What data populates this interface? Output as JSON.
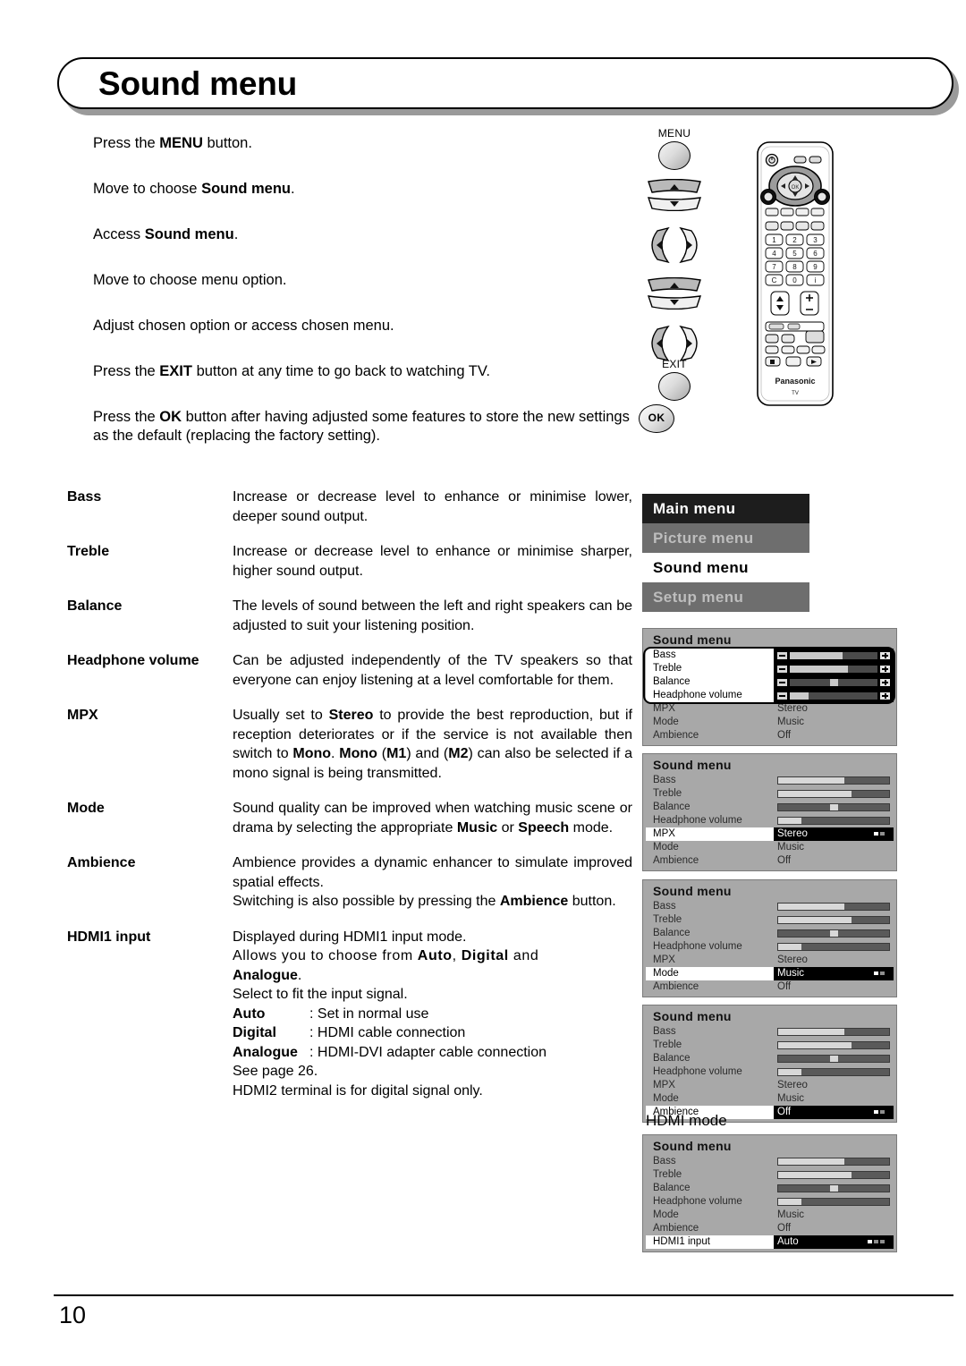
{
  "page": {
    "title": "Sound menu",
    "number": "10"
  },
  "steps": [
    {
      "id": "menu",
      "html": "Press the <b>MENU</b> button."
    },
    {
      "id": "move1",
      "html": "Move to choose <b>Sound menu</b>."
    },
    {
      "id": "access",
      "html": "Access <b>Sound menu</b>."
    },
    {
      "id": "move2",
      "html": "Move to choose menu option."
    },
    {
      "id": "adjust",
      "html": "Adjust chosen option or access chosen menu."
    },
    {
      "id": "exit",
      "html": "Press the <b>EXIT</b> button at any time to go back to watching TV."
    },
    {
      "id": "ok",
      "html": "Press the <b>OK</b> button after having adjusted some features to store the new settings as the default (replacing the factory setting)."
    }
  ],
  "remote_keys": {
    "menu_label": "MENU",
    "exit_label": "EXIT",
    "ok_label": "OK"
  },
  "remote_device": {
    "brand": "Panasonic",
    "sub_brand": "TV",
    "numbers": [
      "1",
      "2",
      "3",
      "4",
      "5",
      "6",
      "7",
      "8",
      "9",
      "C",
      "0"
    ]
  },
  "features": [
    {
      "term": "Bass",
      "desc_html": "Increase or decrease level to enhance or minimise lower, deeper sound output."
    },
    {
      "term": "Treble",
      "desc_html": "Increase or decrease level to enhance or minimise sharper, higher sound output."
    },
    {
      "term": "Balance",
      "desc_html": "The levels of sound between the left and right speakers can be adjusted to suit your listening position."
    },
    {
      "term": "Headphone volume",
      "desc_html": "Can be adjusted independently of the TV speakers so that everyone can enjoy listening at a level comfortable for them."
    },
    {
      "term": "MPX",
      "desc_html": "Usually set to <b>Stereo</b> to provide the best reproduction, but if reception deteriorates or if the service is not available then switch to <b>Mono</b>. <b>Mono</b> (<b>M1</b>) and (<b>M2</b>) can also be selected if a mono signal is being transmitted."
    },
    {
      "term": "Mode",
      "desc_html": "Sound quality can be improved when watching music scene or drama by selecting the appropriate <b>Music</b> or <b>Speech</b> mode."
    },
    {
      "term": "Ambience",
      "desc_html": "Ambience provides a dynamic enhancer to simulate improved spatial effects.<br>Switching is also possible by pressing the <b>Ambience</b> button."
    },
    {
      "term": "HDMI1 input",
      "desc_html": "Displayed during HDMI1 input mode.<br><span class=\"spaced\">Allows you to choose from <b>Auto</b>, <b>Digital</b> and</span><br><b>Analogue</b>.<br>Select to fit the input signal.<div class=\"kv\"><span class=\"k\">Auto</span><span class=\"v\">: Set in normal use</span></div><div class=\"kv\"><span class=\"k\">Digital</span><span class=\"v\">: HDMI cable connection</span></div><div class=\"kv\"><span class=\"k\">Analogue</span><span class=\"v\">: HDMI-DVI adapter cable connection</span></div>See page 26.<br>HDMI2 terminal is for digital signal only."
    }
  ],
  "main_menu": {
    "title": "Main menu",
    "items": [
      {
        "label": "Picture menu",
        "state": "dim"
      },
      {
        "label": "Sound menu",
        "state": "selected"
      },
      {
        "label": "Setup menu",
        "state": "dim"
      }
    ]
  },
  "hdmi_caption": "HDMI mode",
  "osd_screens": [
    {
      "id": "osd-adjust-bars",
      "title": "Sound menu",
      "boxed_rows": 4,
      "rows": [
        {
          "label": "Bass",
          "type": "bar",
          "fill": 60,
          "boxed": true
        },
        {
          "label": "Treble",
          "type": "bar",
          "fill": 66,
          "boxed": true
        },
        {
          "label": "Balance",
          "type": "bar",
          "fill": 0,
          "knob": 50,
          "boxed": true
        },
        {
          "label": "Headphone volume",
          "type": "bar",
          "fill": 21,
          "boxed": true
        },
        {
          "label": "MPX",
          "type": "text",
          "value": "Stereo"
        },
        {
          "label": "Mode",
          "type": "text",
          "value": "Music"
        },
        {
          "label": "Ambience",
          "type": "text",
          "value": "Off"
        }
      ]
    },
    {
      "id": "osd-mpx",
      "title": "Sound menu",
      "rows": [
        {
          "label": "Bass",
          "type": "bar",
          "fill": 60
        },
        {
          "label": "Treble",
          "type": "bar",
          "fill": 66
        },
        {
          "label": "Balance",
          "type": "bar",
          "fill": 0,
          "knob": 50
        },
        {
          "label": "Headphone volume",
          "type": "bar",
          "fill": 21
        },
        {
          "label": "MPX",
          "type": "text",
          "value": "Stereo",
          "selected": true
        },
        {
          "label": "Mode",
          "type": "text",
          "value": "Music"
        },
        {
          "label": "Ambience",
          "type": "text",
          "value": "Off"
        }
      ]
    },
    {
      "id": "osd-mode",
      "title": "Sound menu",
      "rows": [
        {
          "label": "Bass",
          "type": "bar",
          "fill": 60
        },
        {
          "label": "Treble",
          "type": "bar",
          "fill": 66
        },
        {
          "label": "Balance",
          "type": "bar",
          "fill": 0,
          "knob": 50
        },
        {
          "label": "Headphone volume",
          "type": "bar",
          "fill": 21
        },
        {
          "label": "MPX",
          "type": "text",
          "value": "Stereo"
        },
        {
          "label": "Mode",
          "type": "text",
          "value": "Music",
          "selected": true
        },
        {
          "label": "Ambience",
          "type": "text",
          "value": "Off"
        }
      ]
    },
    {
      "id": "osd-ambience",
      "title": "Sound menu",
      "rows": [
        {
          "label": "Bass",
          "type": "bar",
          "fill": 60
        },
        {
          "label": "Treble",
          "type": "bar",
          "fill": 66
        },
        {
          "label": "Balance",
          "type": "bar",
          "fill": 0,
          "knob": 50
        },
        {
          "label": "Headphone volume",
          "type": "bar",
          "fill": 21
        },
        {
          "label": "MPX",
          "type": "text",
          "value": "Stereo"
        },
        {
          "label": "Mode",
          "type": "text",
          "value": "Music"
        },
        {
          "label": "Ambience",
          "type": "text",
          "value": "Off",
          "selected": true
        }
      ]
    },
    {
      "id": "osd-hdmi",
      "title": "Sound menu",
      "rows": [
        {
          "label": "Bass",
          "type": "bar",
          "fill": 60
        },
        {
          "label": "Treble",
          "type": "bar",
          "fill": 66
        },
        {
          "label": "Balance",
          "type": "bar",
          "fill": 0,
          "knob": 50
        },
        {
          "label": "Headphone volume",
          "type": "bar",
          "fill": 21
        },
        {
          "label": "Mode",
          "type": "text",
          "value": "Music"
        },
        {
          "label": "Ambience",
          "type": "text",
          "value": "Off"
        },
        {
          "label": "HDMI1 input",
          "type": "text",
          "value": "Auto",
          "selected": true
        }
      ]
    }
  ],
  "colors": {
    "osd_background": "#a8a8a8",
    "osd_selected_value_bg": "#000000",
    "osd_selected_label_bg": "#ffffff",
    "main_menu_title_bg": "#1d1d1d",
    "main_menu_dim_bg": "#6e6e6e",
    "main_menu_selected_bg": "#ffffff"
  }
}
